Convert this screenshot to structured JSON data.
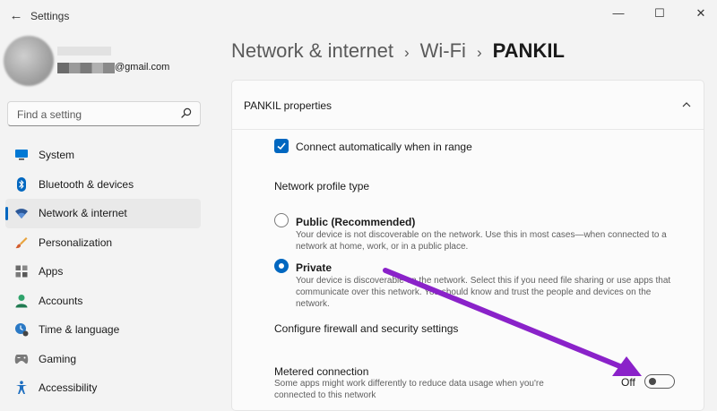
{
  "window": {
    "title": "Settings",
    "back_glyph": "←",
    "minimize_glyph": "—",
    "maximize_glyph": "☐",
    "close_glyph": "✕"
  },
  "account": {
    "email_suffix": "@gmail.com"
  },
  "search": {
    "placeholder": "Find a setting"
  },
  "sidebar": {
    "items": [
      {
        "label": "System",
        "icon": "monitor-icon"
      },
      {
        "label": "Bluetooth & devices",
        "icon": "bluetooth-icon"
      },
      {
        "label": "Network & internet",
        "icon": "network-icon",
        "selected": true
      },
      {
        "label": "Personalization",
        "icon": "brush-icon"
      },
      {
        "label": "Apps",
        "icon": "apps-icon"
      },
      {
        "label": "Accounts",
        "icon": "person-icon"
      },
      {
        "label": "Time & language",
        "icon": "clock-icon"
      },
      {
        "label": "Gaming",
        "icon": "gamepad-icon"
      },
      {
        "label": "Accessibility",
        "icon": "accessibility-icon"
      }
    ]
  },
  "breadcrumb": {
    "part1": "Network & internet",
    "part2": "Wi-Fi",
    "current": "PANKIL",
    "separator": "›"
  },
  "properties": {
    "title": "PANKIL properties",
    "auto_connect_label": "Connect automatically when in range",
    "auto_connect_checked": true,
    "profile_type_label": "Network profile type",
    "public_title": "Public (Recommended)",
    "public_desc": "Your device is not discoverable on the network. Use this in most cases—when connected to a network at home, work, or in a public place.",
    "private_title": "Private",
    "private_desc": "Your device is discoverable on the network. Select this if you need file sharing or use apps that communicate over this network. You should know and trust the people and devices on the network.",
    "selected_profile": "Private",
    "firewall_link": "Configure firewall and security settings",
    "metered_title": "Metered connection",
    "metered_desc": "Some apps might work differently to reduce data usage when you're connected to this network",
    "metered_state": "Off"
  },
  "colors": {
    "accent": "#0067c0",
    "annotation_arrow": "#8a22c9"
  }
}
